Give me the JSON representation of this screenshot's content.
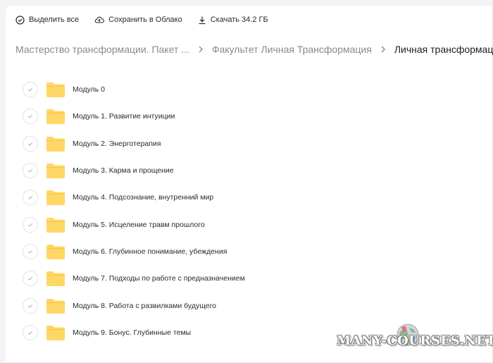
{
  "toolbar": {
    "select_all": "Выделить все",
    "save_cloud": "Сохранить в Облако",
    "download": "Скачать 34.2 ГБ"
  },
  "breadcrumb": {
    "items": [
      "Мастерство трансформации. Пакет ...",
      "Факультет Личная Трансформация",
      "Личная трансформация"
    ]
  },
  "folders": [
    "Модуль 0",
    "Модуль 1. Развитие интуиции",
    "Модуль 2. Энерготерапия",
    "Модуль 3. Карма и прощение",
    "Модуль 4. Подсознание, внутренний мир",
    "Модуль 5. Исцеление травм прошлого",
    "Модуль 6. Глубинное понимание, убеждения",
    "Модуль 7. Подходы по работе с предназначением",
    "Модуль 8. Работа с развилками будущего",
    "Модуль 9. Бонус. Глубинные темы"
  ],
  "watermark": "MANY-COURSES.NET",
  "colors": {
    "folder": "#ffd766",
    "folder_tab": "#f5c542",
    "muted_text": "#8a8a8a",
    "text": "#2a2a2a"
  },
  "icons": [
    "check-circle-icon",
    "cloud-upload-icon",
    "download-icon",
    "chevron-right-icon",
    "folder-icon",
    "checkmark-icon"
  ]
}
